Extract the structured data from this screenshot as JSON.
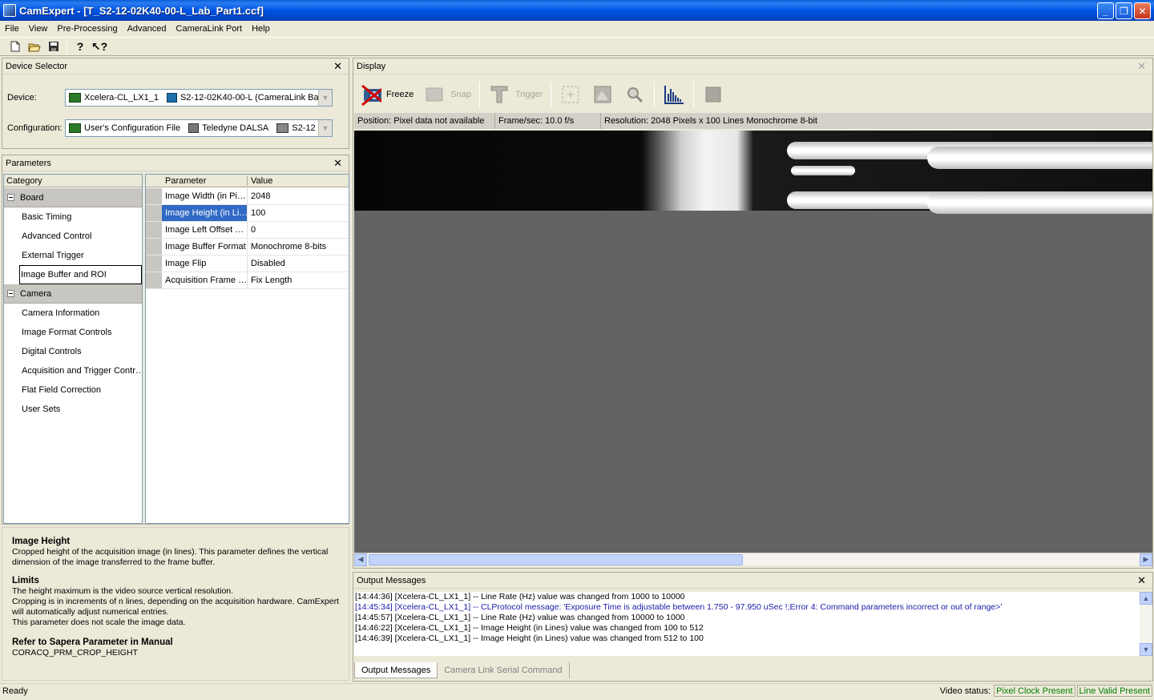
{
  "window": {
    "title": "CamExpert - [T_S2-12-02K40-00-L_Lab_Part1.ccf]",
    "controls": [
      "_",
      "❐",
      "✕"
    ]
  },
  "menu": [
    "File",
    "View",
    "Pre-Processing",
    "Advanced",
    "CameraLink Port",
    "Help"
  ],
  "toolbar": {
    "icons": [
      "new-file-icon",
      "open-folder-icon",
      "save-icon",
      "help-icon",
      "context-help-icon"
    ]
  },
  "device_selector": {
    "title": "Device Selector",
    "device_label": "Device:",
    "device_board": "Xcelera-CL_LX1_1",
    "device_camera": "S2-12-02K40-00-L (CameraLink Ba",
    "config_label": "Configuration:",
    "config_file": "User's Configuration File",
    "config_vendor": "Teledyne DALSA",
    "config_model": "S2-12"
  },
  "parameters": {
    "title": "Parameters",
    "category_header": "Category",
    "param_header": "Parameter",
    "value_header": "Value",
    "groups": [
      {
        "name": "Board",
        "items": [
          "Basic Timing",
          "Advanced Control",
          "External Trigger",
          "Image Buffer and ROI"
        ]
      },
      {
        "name": "Camera",
        "items": [
          "Camera Information",
          "Image Format Controls",
          "Digital Controls",
          "Acquisition and Trigger Contr…",
          "Flat Field Correction",
          "User Sets"
        ]
      }
    ],
    "rows": [
      {
        "name": "Image Width (in Pi…",
        "value": "2048"
      },
      {
        "name": "Image Height (in Li…",
        "value": "100"
      },
      {
        "name": "Image Left Offset …",
        "value": "0"
      },
      {
        "name": "Image Buffer Format",
        "value": "Monochrome 8-bits"
      },
      {
        "name": "Image Flip",
        "value": "Disabled"
      },
      {
        "name": "Acquisition Frame …",
        "value": "Fix Length"
      }
    ]
  },
  "help": {
    "title": "Image Height",
    "desc": "Cropped height of the acquisition image (in lines). This parameter defines the vertical dimension of the image transferred to the frame buffer.",
    "limits_title": "Limits",
    "limits_1": "The height maximum is the video source vertical resolution.",
    "limits_2": "Cropping is in increments of n lines, depending on the acquisition hardware. CamExpert will automatically adjust numerical entries.",
    "limits_3": "This parameter does not scale the image data.",
    "ref_title": "Refer to Sapera Parameter in Manual",
    "ref_value": "CORACQ_PRM_CROP_HEIGHT"
  },
  "display": {
    "title": "Display",
    "buttons": {
      "freeze": "Freeze",
      "snap": "Snap",
      "trigger": "Trigger"
    },
    "position": "Position:   Pixel data not available",
    "fps": "Frame/sec:  10.0 f/s",
    "resolution": "Resolution:   2048 Pixels x 100 Lines   Monochrome 8-bit"
  },
  "output": {
    "title": "Output Messages",
    "lines": [
      {
        "text": "[14:44:36] [Xcelera-CL_LX1_1]  -- Line Rate (Hz) value was changed from 1000 to 10000",
        "kind": "normal"
      },
      {
        "text": "[14:45:34] [Xcelera-CL_LX1_1]  -- CLProtocol message: 'Exposure Time is adjustable between 1.750 - 97.950 uSec !;Error 4: Command parameters incorrect or out of range>'",
        "kind": "info"
      },
      {
        "text": "[14:45:57] [Xcelera-CL_LX1_1]  -- Line Rate (Hz) value was changed from 10000 to 1000",
        "kind": "normal"
      },
      {
        "text": "[14:46:22] [Xcelera-CL_LX1_1]  -- Image Height (in Lines) value was changed from 100 to 512",
        "kind": "normal"
      },
      {
        "text": "[14:46:39] [Xcelera-CL_LX1_1]  -- Image Height (in Lines) value was changed from 512 to 100",
        "kind": "normal"
      }
    ],
    "tabs": [
      "Output Messages",
      "Camera Link Serial Command"
    ]
  },
  "status": {
    "ready": "Ready",
    "video_label": "Video status:",
    "pixel_clock": "Pixel Clock Present",
    "line_valid": "Line Valid Present"
  }
}
